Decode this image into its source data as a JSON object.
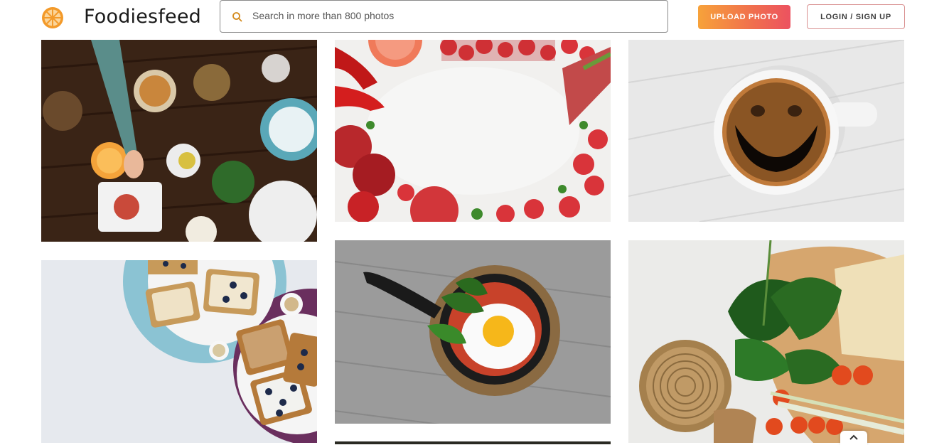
{
  "brand": {
    "name": "Foodiesfeed",
    "logo_icon": "orange-slice-icon"
  },
  "search": {
    "placeholder": "Search in more than 800 photos",
    "value": "",
    "icon": "search-icon"
  },
  "header": {
    "upload_label": "UPLOAD PHOTO",
    "login_label": "LOGIN / SIGN UP"
  },
  "colors": {
    "accent_start": "#f7a23a",
    "accent_end": "#ec5260",
    "login_border": "#d99090"
  },
  "photos": [
    {
      "id": "table-feast",
      "description_icon": "photo"
    },
    {
      "id": "fruits-frame",
      "description_icon": "photo"
    },
    {
      "id": "coffee-smile",
      "description_icon": "photo"
    },
    {
      "id": "toast-blueberries",
      "description_icon": "photo"
    },
    {
      "id": "egg-skillet",
      "description_icon": "photo"
    },
    {
      "id": "bread-cheese",
      "description_icon": "photo"
    },
    {
      "id": "partial-photo",
      "description_icon": "photo"
    }
  ],
  "scroll_top": {
    "icon": "chevron-up-icon"
  }
}
